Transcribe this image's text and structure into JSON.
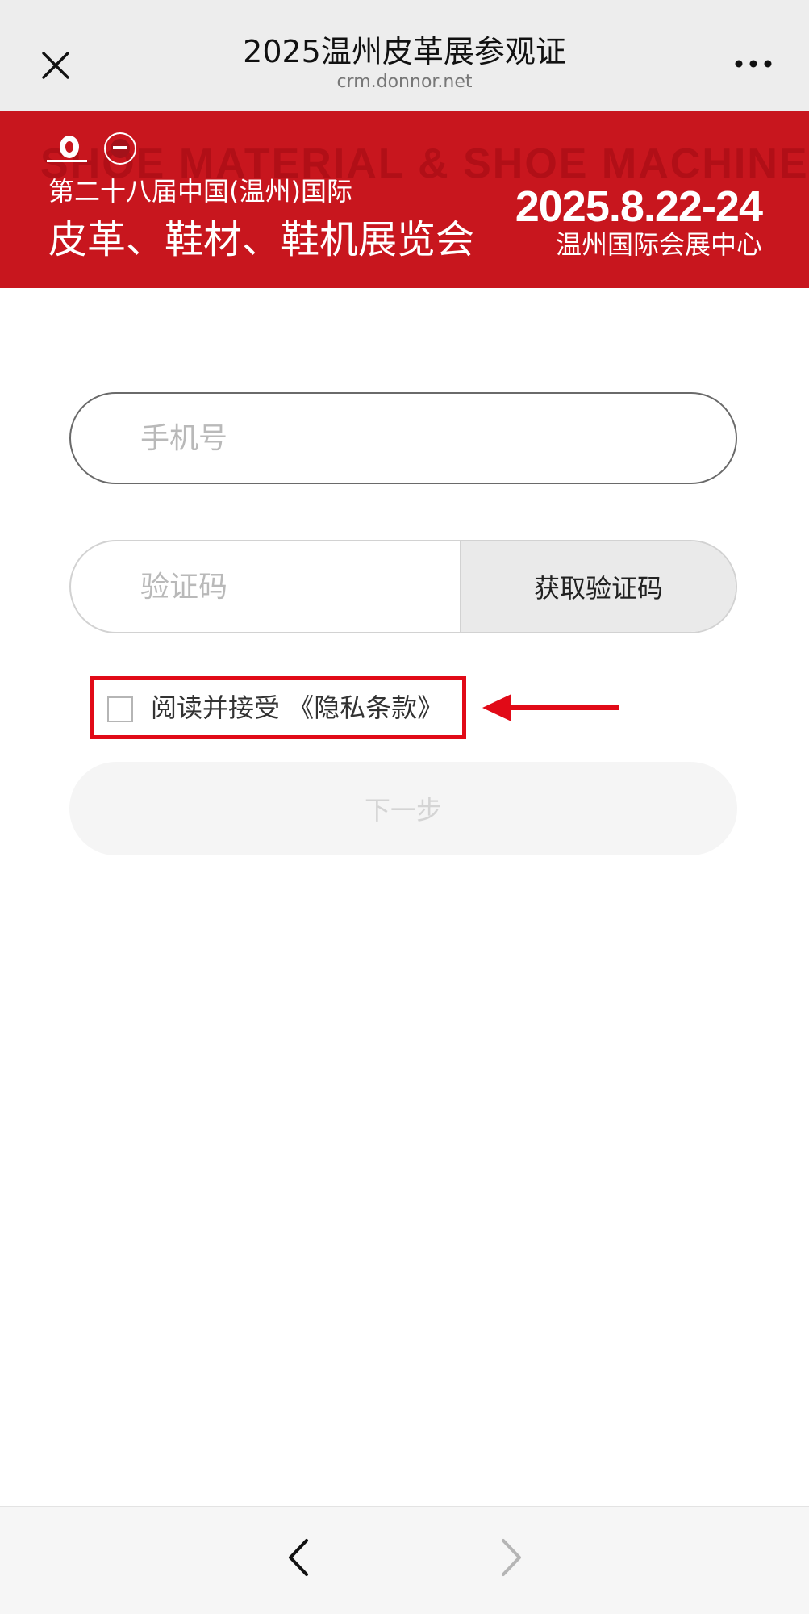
{
  "navbar": {
    "title": "2025温州皮革展参观证",
    "url": "crm.donnor.net",
    "close_icon": "close-icon",
    "more_icon": "more-icon"
  },
  "banner": {
    "watermark": "SHOE MATERIAL & SHOE MACHINERY FAIR",
    "line1": "第二十八届中国(温州)国际",
    "line2": "皮革、鞋材、鞋机展览会",
    "date": "2025.8.22-24",
    "venue": "温州国际会展中心",
    "background_color": "#c8161e"
  },
  "form": {
    "phone_placeholder": "手机号",
    "phone_value": "",
    "code_placeholder": "验证码",
    "code_value": "",
    "get_code_label": "获取验证码",
    "agree_prefix": "阅读并接受",
    "privacy_link": "《隐私条款》",
    "agree_checked": false,
    "next_label": "下一步",
    "next_enabled": false
  },
  "annotation": {
    "highlight_color": "#e10a17"
  },
  "bottombar": {
    "back_icon": "chevron-left-icon",
    "forward_icon": "chevron-right-icon"
  }
}
